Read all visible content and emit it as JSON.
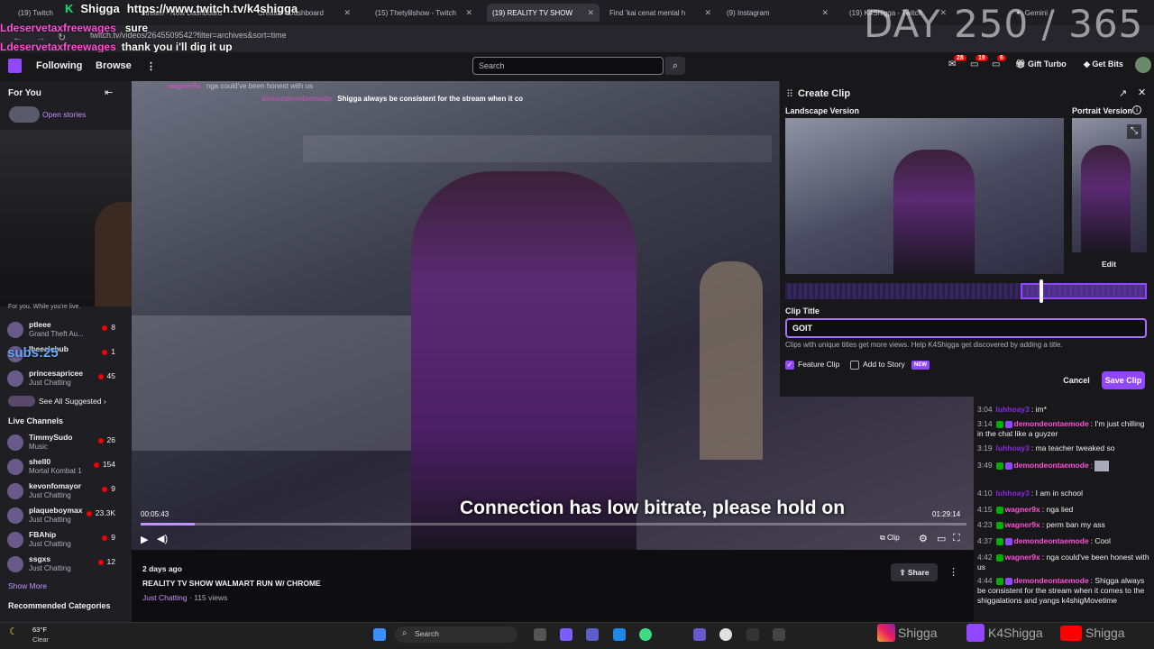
{
  "browser": {
    "tabs": [
      {
        "label": "(19) Twitch"
      },
      {
        "label": "Stream - Now Dashboard"
      },
      {
        "label": "Creator - Dashboard"
      },
      {
        "label": "(15) Thetylilshow - Twitch"
      },
      {
        "label": "(19) REALITY TV SHOW"
      },
      {
        "label": "Find 'kai cenat mental h"
      },
      {
        "label": "(9) Instagram"
      },
      {
        "label": "(19) K4Shigga - Twitch"
      }
    ],
    "profile_label": "Gemini",
    "url": "twitch.tv/videos/2645509542?filter=archives&sort=time"
  },
  "stream_overlay": {
    "line1_user": "Shigga",
    "line1_text": "https://www.twitch.tv/k4shigga",
    "line2_user": "Ldeservetaxfreewages",
    "line2_text": "sure",
    "line3_user": "Ldeservetaxfreewages",
    "line3_text": "thank you i'll dig it up",
    "day_counter": "DAY 250 / 365",
    "subs_label": "subs:25",
    "bitrate_warning": "Connection has low bitrate, please hold on",
    "timestamp": "01:29:14",
    "video_chat_line1_user": "wagner9x",
    "video_chat_line1_text": "nga could've been honest with us",
    "video_chat_line2_user": "demondeontaemode",
    "video_chat_line2_text": "Shigga always be consistent for the stream when it co"
  },
  "twitch_nav": {
    "following": "Following",
    "browse": "Browse",
    "search_placeholder": "Search",
    "notif_count_1": "28",
    "notif_count_2": "19",
    "notif_count_3": "6",
    "gift_turbo": "Gift Turbo",
    "get_bits": "Get Bits"
  },
  "sidebar": {
    "for_you": "For You",
    "open_stories": "Open stories",
    "for_you_note": "For you. While you're live.",
    "suggested": [
      {
        "name": "ptleee",
        "category": "Grand Theft Au...",
        "viewers": "8"
      },
      {
        "name": "lbeezlebub",
        "category": "",
        "viewers": "1"
      },
      {
        "name": "princesapricee",
        "category": "Just Chatting",
        "viewers": "45"
      }
    ],
    "see_all": "See All Suggested",
    "live_channels_heading": "Live Channels",
    "live": [
      {
        "name": "TimmySudo",
        "category": "Music",
        "viewers": "26"
      },
      {
        "name": "shell0",
        "category": "Mortal Kombat 1",
        "viewers": "154"
      },
      {
        "name": "kevonfomayor",
        "category": "Just Chatting",
        "viewers": "9"
      },
      {
        "name": "plaqueboymax",
        "category": "Just Chatting",
        "viewers": "23.3K"
      },
      {
        "name": "FBAhip",
        "category": "Just Chatting",
        "viewers": "9"
      },
      {
        "name": "ssgxs",
        "category": "Just Chatting",
        "viewers": "12"
      }
    ],
    "show_more": "Show More",
    "recommended_categories": "Recommended Categories"
  },
  "player": {
    "elapsed": "00:05:43",
    "clip_label": "Clip",
    "progress_fraction": 0.065
  },
  "video_info": {
    "posted": "2 days ago",
    "title": "REALITY TV SHOW WALMART RUN W/ CHROME",
    "category": "Just Chatting",
    "views": "115 views",
    "share": "Share"
  },
  "clip": {
    "heading": "Create Clip",
    "landscape": "Landscape Version",
    "portrait": "Portrait Version",
    "edit": "Edit",
    "title_label": "Clip Title",
    "title_value": "GOIT",
    "hint": "Clips with unique titles get more views. Help K4Shigga get discovered by adding a title.",
    "feature_clip": "Feature Clip",
    "add_to_story": "Add to Story",
    "new_badge": "NEW",
    "cancel": "Cancel",
    "save": "Save Clip",
    "feature_checked": true,
    "story_checked": false
  },
  "chat": [
    {
      "time": "3:04",
      "user": "luhhoay3",
      "text": "im*",
      "color": "#8a2be2"
    },
    {
      "time": "3:14",
      "user": "demondeontaemode",
      "text": "I'm just chilling in the chat like a guyzer",
      "color": "#ff4fd8"
    },
    {
      "time": "3:19",
      "user": "luhhoay3",
      "text": "ma teacher tweaked so",
      "color": "#8a2be2"
    },
    {
      "time": "3:49",
      "user": "demondeontaemode",
      "text": "",
      "color": "#ff4fd8"
    },
    {
      "time": "4:10",
      "user": "luhhoay3",
      "text": "I am in school",
      "color": "#8a2be2"
    },
    {
      "time": "4:15",
      "user": "wagner9x",
      "text": "nga lied",
      "color": "#ff4fd8"
    },
    {
      "time": "4:23",
      "user": "wagner9x",
      "text": "perm ban my ass",
      "color": "#ff4fd8"
    },
    {
      "time": "4:37",
      "user": "demondeontaemode",
      "text": "Cool",
      "color": "#ff4fd8"
    },
    {
      "time": "4:42",
      "user": "wagner9x",
      "text": "nga could've been honest with us",
      "color": "#ff4fd8"
    },
    {
      "time": "4:44",
      "user": "demondeontaemode",
      "text": "Shigga always be consistent for the stream when it comes to the shiggalations and yangs",
      "color": "#ff4fd8"
    },
    {
      "time": "",
      "user": "",
      "text": "k4shigMovetime",
      "color": "#ff4fd8"
    }
  ],
  "taskbar": {
    "weather_temp": "63°F",
    "weather_desc": "Clear",
    "search": "Search",
    "social_1": "Shigga",
    "social_2": "K4Shigga",
    "social_3": "Shigga"
  }
}
